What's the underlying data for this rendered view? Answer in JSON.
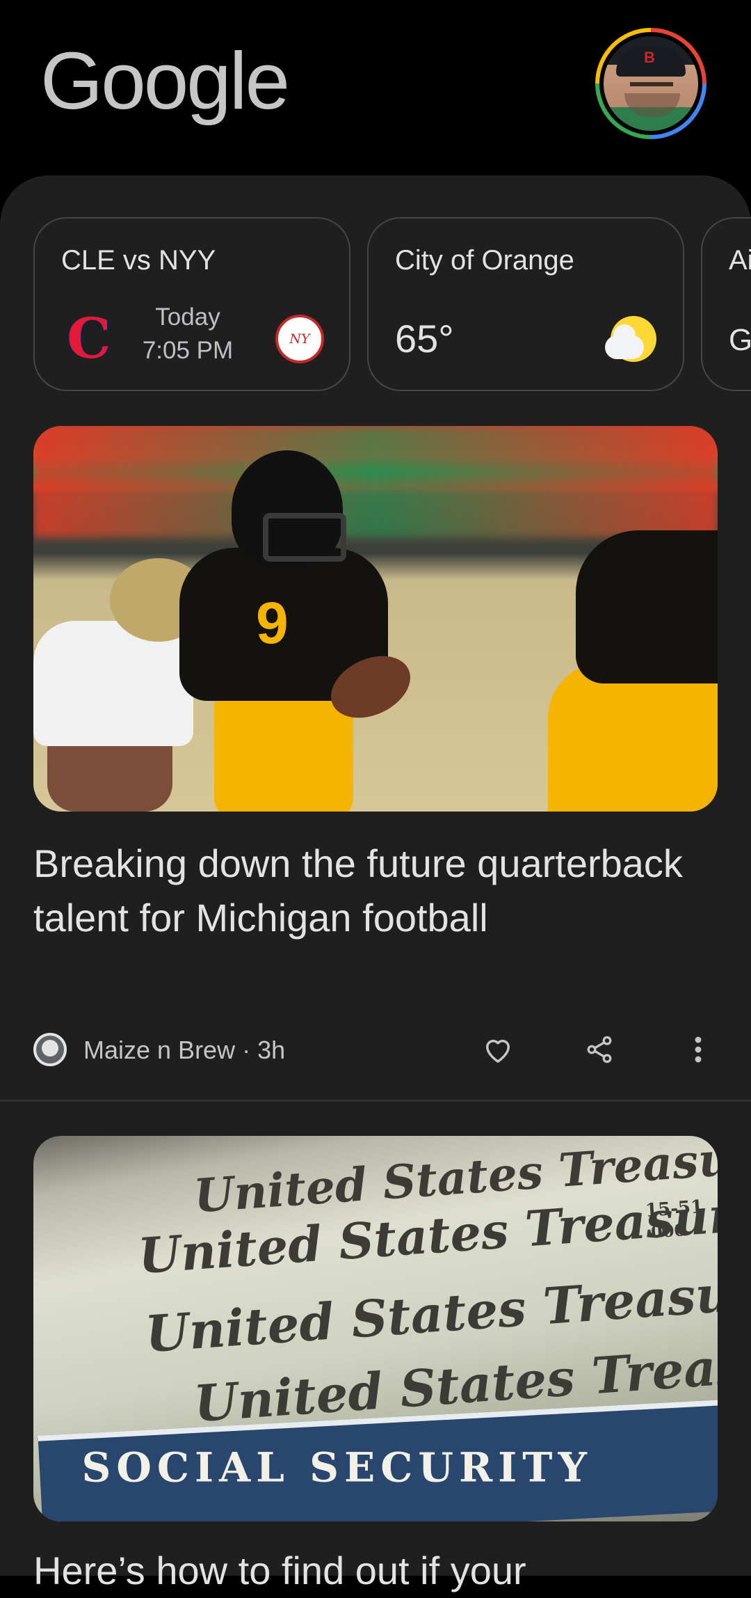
{
  "header": {
    "logo_text": "Google",
    "avatar_label": "Account"
  },
  "chips": [
    {
      "title": "CLE vs NYY",
      "day": "Today",
      "time": "7:05 PM",
      "home_team_icon": "cleveland-guardians-logo",
      "away_team_icon": "new-york-yankees-logo"
    },
    {
      "title": "City of Orange",
      "temperature": "65°",
      "weather_icon": "partly-cloudy-icon"
    },
    {
      "title": "Ai",
      "subtitle": "G"
    }
  ],
  "articles": [
    {
      "headline": "Breaking down the future quarterback talent for Michigan football",
      "source": "Maize n Brew · 3h",
      "image_jersey_text": "9"
    },
    {
      "headline": "Here’s how to find out if your",
      "treasury_lines": [
        "United States Treasury",
        "United States Treasury",
        "United States Treasury",
        "United States Treasury"
      ],
      "treasury_codes": [
        "15-51",
        "000"
      ],
      "card_text": "SOCIAL SECURITY"
    }
  ],
  "colors": {
    "background": "#000000",
    "feed": "#1f1f1f",
    "text": "#e3e3e3",
    "secondary_text": "#c4c7c5"
  }
}
